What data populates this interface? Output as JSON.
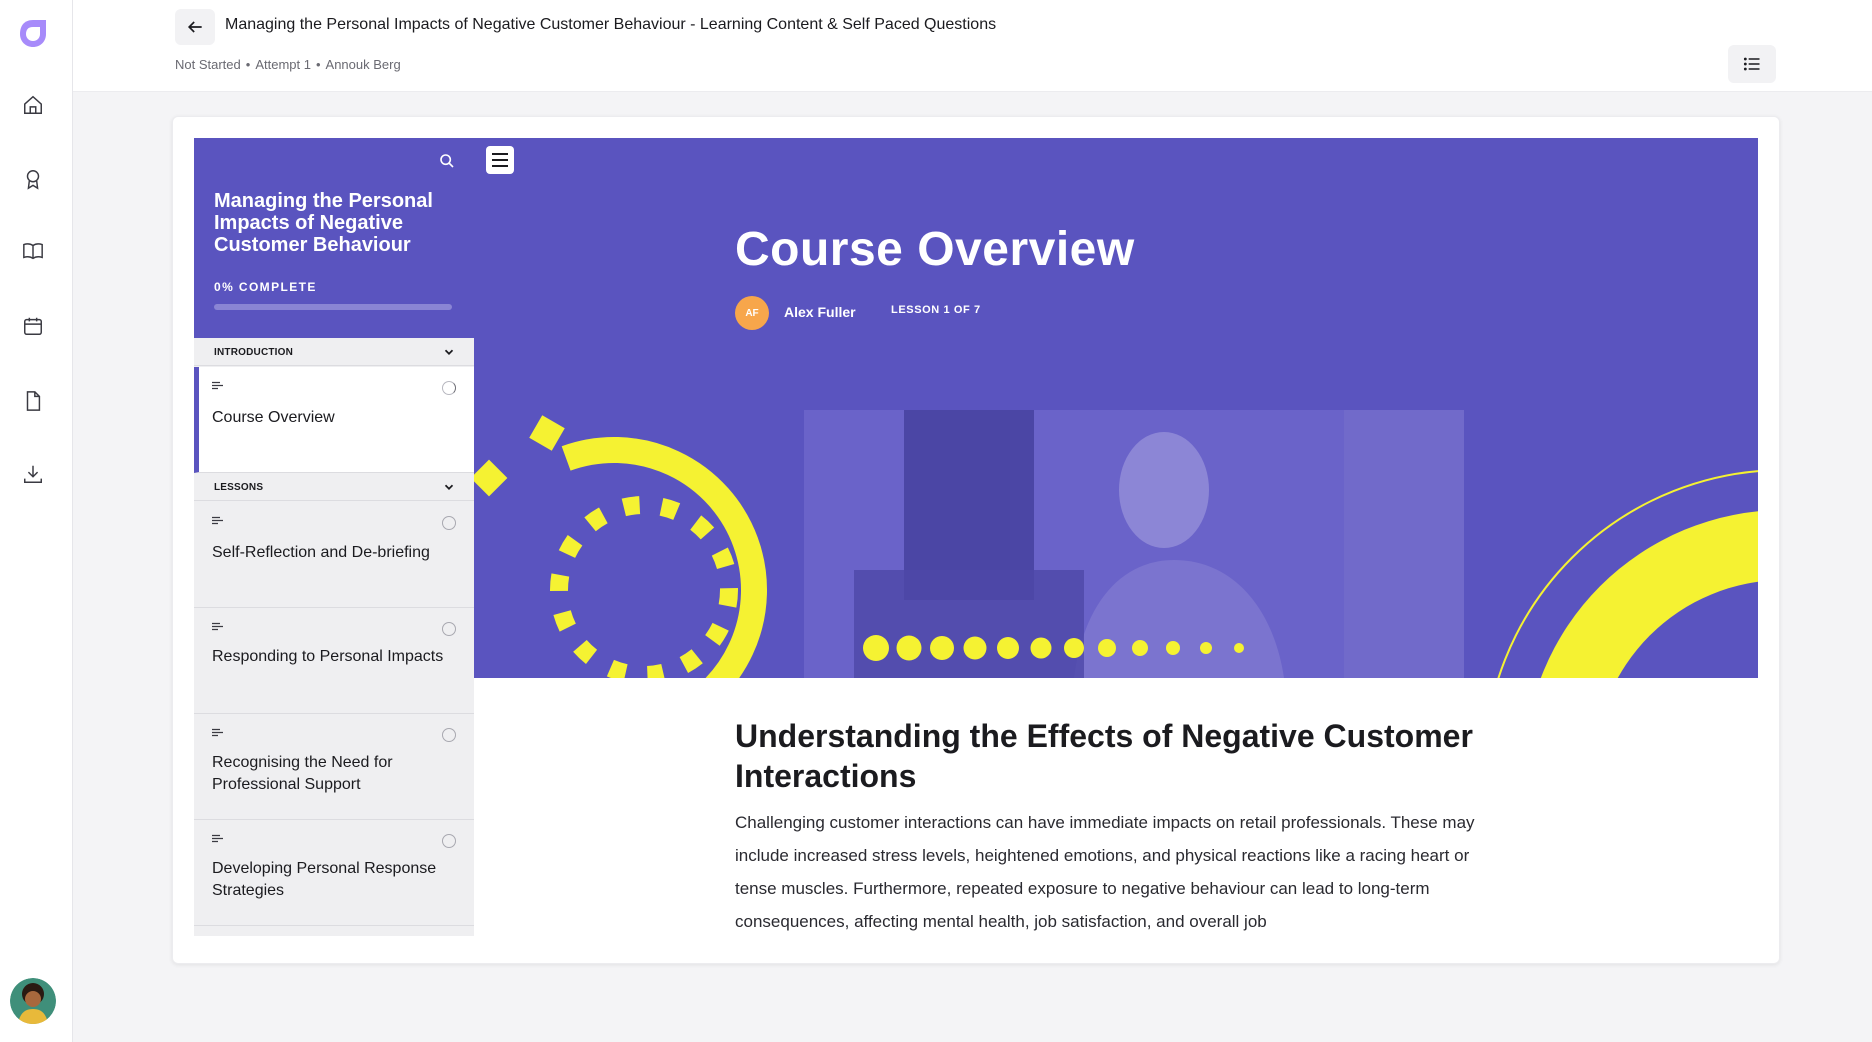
{
  "nav": {
    "items": [
      {
        "name": "home-icon"
      },
      {
        "name": "award-icon"
      },
      {
        "name": "book-icon"
      },
      {
        "name": "calendar-icon"
      },
      {
        "name": "file-icon"
      },
      {
        "name": "download-icon"
      }
    ]
  },
  "header": {
    "title": "Managing the Personal Impacts of Negative Customer Behaviour - Learning Content & Self Paced Questions",
    "status": "Not Started",
    "attempt": "Attempt 1",
    "user": "Annouk Berg",
    "separator": "•"
  },
  "course": {
    "title": "Managing the Personal Impacts of Negative Customer Behaviour",
    "progress_label": "0% COMPLETE",
    "progress": 0,
    "sections": [
      {
        "label": "INTRODUCTION"
      },
      {
        "label": "LESSONS"
      }
    ],
    "lessons": [
      {
        "title": "Course Overview"
      },
      {
        "title": "Self-Reflection and De-briefing"
      },
      {
        "title": "Responding to Personal Impacts"
      },
      {
        "title": "Recognising the Need for Professional Support"
      },
      {
        "title": "Developing Personal Response Strategies"
      }
    ]
  },
  "lesson_view": {
    "title": "Course Overview",
    "author_initials": "AF",
    "author_name": "Alex Fuller",
    "lesson_count": "LESSON 1 OF 7",
    "heading": "Understanding the Effects of Negative Customer Interactions",
    "body": "Challenging customer interactions can have immediate impacts on retail professionals. These may include increased stress levels, heightened emotions, and physical reactions like a racing heart or tense muscles. Furthermore, repeated exposure to negative behaviour can lead to long-term consequences, affecting mental health, job satisfaction, and overall job"
  },
  "colors": {
    "brand": "#5a54bf",
    "accent": "#f5f232",
    "avatar": "#f7a64b"
  }
}
